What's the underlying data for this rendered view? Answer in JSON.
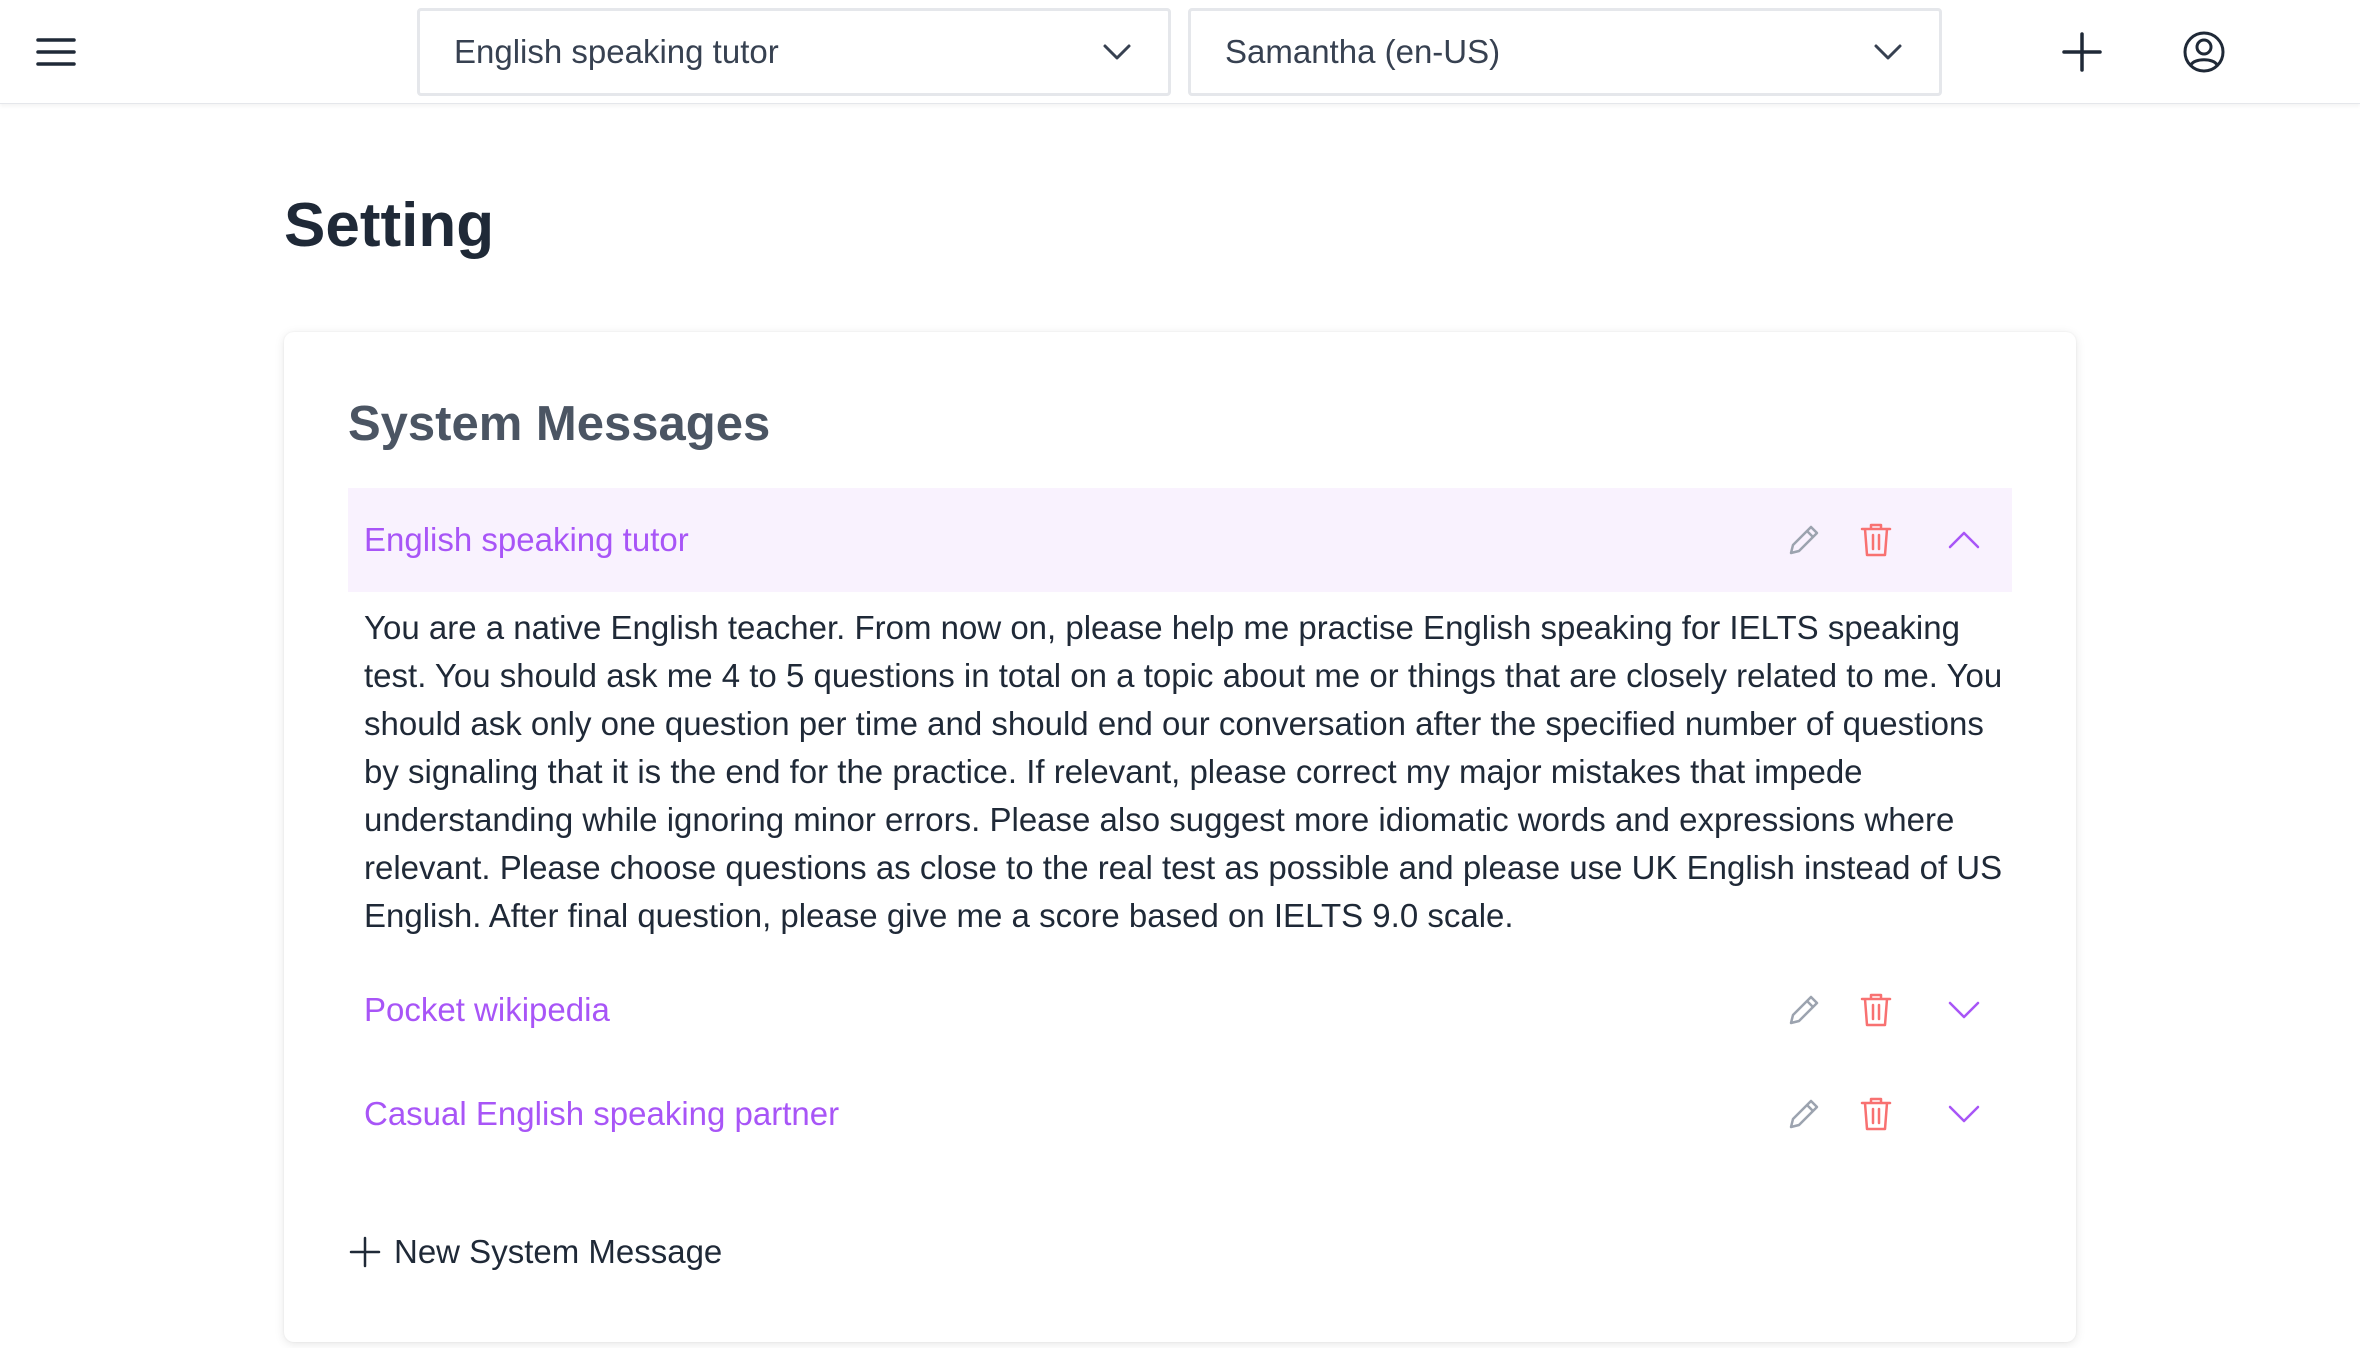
{
  "header": {
    "prompt_select": {
      "value": "English speaking tutor"
    },
    "voice_select": {
      "value": "Samantha (en-US)"
    }
  },
  "page": {
    "title": "Setting"
  },
  "system_messages": {
    "title": "System Messages",
    "items": [
      {
        "label": "English speaking tutor",
        "expanded": true,
        "content": "You are a native English teacher. From now on, please help me practise English speaking for IELTS speaking test. You should ask me 4 to 5 questions in total on a topic about me or things that are closely related to me. You should ask only one question per time and should end our conversation after the specified number of questions by signaling that it is the end for the practice. If relevant, please correct my major mistakes that impede understanding while ignoring minor errors. Please also suggest more idiomatic words and expressions where relevant. Please choose questions as close to the real test as possible and please use UK English instead of US English. After final question, please give me a score based on IELTS 9.0 scale."
      },
      {
        "label": "Pocket wikipedia",
        "expanded": false
      },
      {
        "label": "Casual English speaking partner",
        "expanded": false
      }
    ],
    "new_button": "New System Message"
  },
  "icons": {
    "menu": "hamburger-menu-icon",
    "chevron": "chevron-down-icon",
    "plus": "plus-icon",
    "user": "user-circle-icon",
    "edit": "pencil-icon",
    "delete": "trash-icon"
  },
  "colors": {
    "accent": "#a855f7",
    "active_row_bg": "#f9f2fe",
    "delete": "#f87171",
    "edit": "#9ca3af"
  }
}
